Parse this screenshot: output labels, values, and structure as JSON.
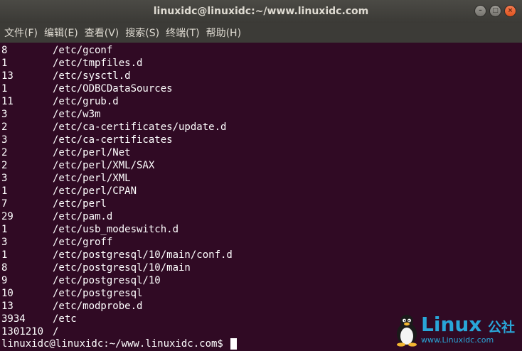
{
  "window": {
    "title": "linuxidc@linuxidc:~/www.linuxidc.com",
    "buttons": {
      "minimize": "–",
      "maximize": "□",
      "close": "×"
    }
  },
  "menubar": {
    "items": [
      "文件(F)",
      "编辑(E)",
      "查看(V)",
      "搜索(S)",
      "终端(T)",
      "帮助(H)"
    ]
  },
  "terminal": {
    "lines": [
      {
        "size": "8",
        "path": "/etc/gconf"
      },
      {
        "size": "1",
        "path": "/etc/tmpfiles.d"
      },
      {
        "size": "13",
        "path": "/etc/sysctl.d"
      },
      {
        "size": "1",
        "path": "/etc/ODBCDataSources"
      },
      {
        "size": "11",
        "path": "/etc/grub.d"
      },
      {
        "size": "3",
        "path": "/etc/w3m"
      },
      {
        "size": "2",
        "path": "/etc/ca-certificates/update.d"
      },
      {
        "size": "3",
        "path": "/etc/ca-certificates"
      },
      {
        "size": "2",
        "path": "/etc/perl/Net"
      },
      {
        "size": "2",
        "path": "/etc/perl/XML/SAX"
      },
      {
        "size": "3",
        "path": "/etc/perl/XML"
      },
      {
        "size": "1",
        "path": "/etc/perl/CPAN"
      },
      {
        "size": "7",
        "path": "/etc/perl"
      },
      {
        "size": "29",
        "path": "/etc/pam.d"
      },
      {
        "size": "1",
        "path": "/etc/usb_modeswitch.d"
      },
      {
        "size": "3",
        "path": "/etc/groff"
      },
      {
        "size": "1",
        "path": "/etc/postgresql/10/main/conf.d"
      },
      {
        "size": "8",
        "path": "/etc/postgresql/10/main"
      },
      {
        "size": "9",
        "path": "/etc/postgresql/10"
      },
      {
        "size": "10",
        "path": "/etc/postgresql"
      },
      {
        "size": "13",
        "path": "/etc/modprobe.d"
      },
      {
        "size": "3934",
        "path": "/etc"
      },
      {
        "size": "1301210",
        "path": "/"
      }
    ],
    "prompt": "linuxidc@linuxidc:~/www.linuxidc.com$"
  },
  "watermark": {
    "word": "Linux",
    "cn": "公社",
    "url": "www.Linuxidc.com"
  },
  "colors": {
    "terminal_bg": "#300a24",
    "titlebar_bg": "#3b3a36",
    "logo_blue": "#29a6d8",
    "close_orange": "#e95420"
  }
}
